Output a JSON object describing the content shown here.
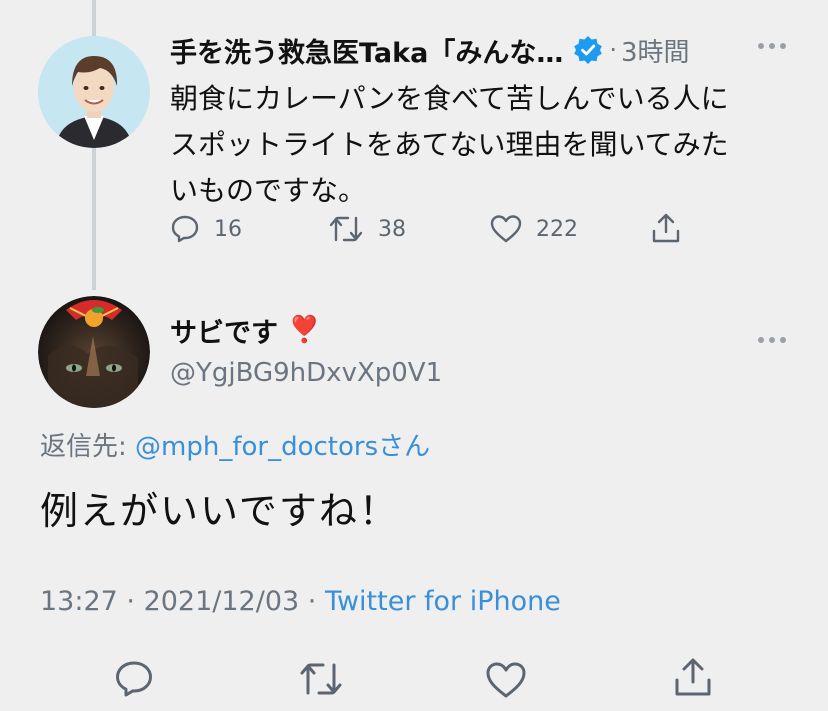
{
  "parent_tweet": {
    "author_name": "手を洗う救急医Taka「みんな…",
    "separator": "·",
    "time": "3時間",
    "text_lines": [
      "朝食にカレーパンを食べて苦しんでいる人に",
      "スポットライトをあてない理由を聞いてみた",
      "いものですな。"
    ],
    "reply_count": "16",
    "retweet_count": "38",
    "like_count": "222",
    "icons": {
      "verified": "verified-badge-icon",
      "more": "more-dots-icon",
      "reply": "reply-icon",
      "retweet": "retweet-icon",
      "like": "heart-icon",
      "share": "share-icon"
    }
  },
  "reply_tweet": {
    "author_name": "サビです",
    "author_emoji": "❣️",
    "handle": "@YgjBG9hDxvXp0V1",
    "replying_label": "返信先: ",
    "replying_to": "@mph_for_doctors",
    "replying_suffix": "さん",
    "text": "例えがいいですね！",
    "time": "13:27",
    "date": "2021/12/03",
    "separator": " · ",
    "source": "Twitter for iPhone"
  },
  "colors": {
    "background": "#efefef",
    "link": "#3a8fd9",
    "verified": "#1d9bf0",
    "icon": "#5c6670",
    "thread_line": "#cfd2d5"
  }
}
